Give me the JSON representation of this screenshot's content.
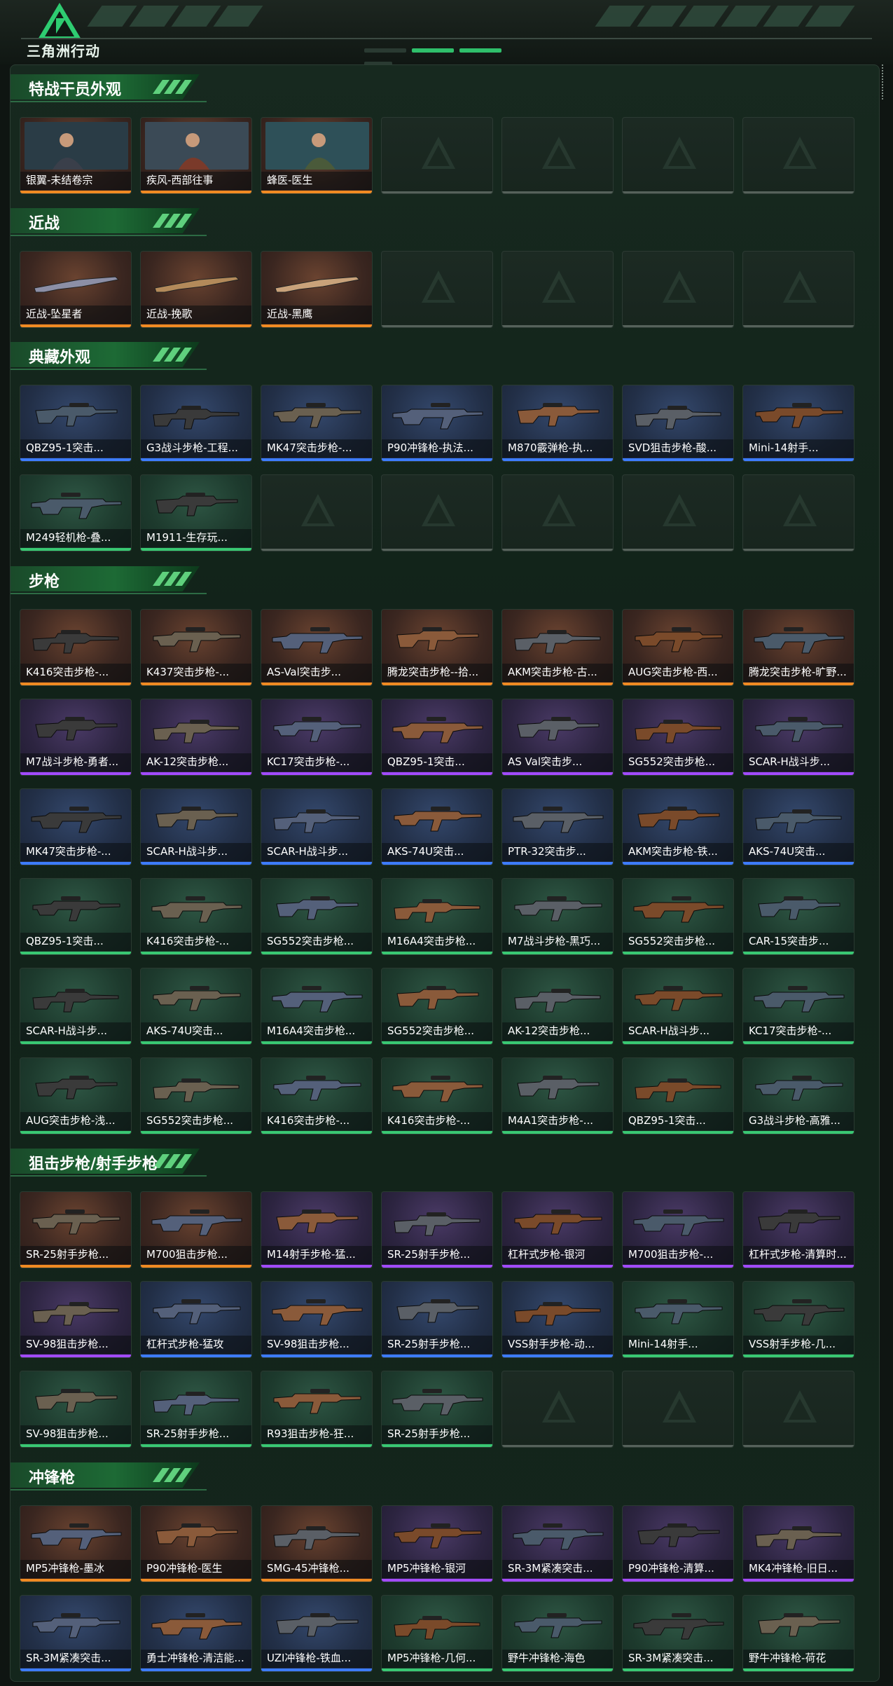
{
  "app": {
    "logo_text": "三角洲行动"
  },
  "colors": {
    "orange": "#f08a23",
    "purple": "#a24bff",
    "blue": "#3d7cff",
    "green": "#39c873",
    "gray": "#56625b",
    "accent": "#2ea35a"
  },
  "sections": [
    {
      "title": "特战干员外观",
      "items": [
        {
          "name": "银翼-未结卷宗",
          "rarity": "orange",
          "kind": "portrait"
        },
        {
          "name": "疾风-西部往事",
          "rarity": "orange",
          "kind": "portrait"
        },
        {
          "name": "蜂医-医生",
          "rarity": "orange",
          "kind": "portrait"
        },
        {
          "name": "",
          "rarity": "empty"
        },
        {
          "name": "",
          "rarity": "empty"
        },
        {
          "name": "",
          "rarity": "empty"
        },
        {
          "name": "",
          "rarity": "empty"
        }
      ]
    },
    {
      "title": "近战",
      "items": [
        {
          "name": "近战-坠星者",
          "rarity": "orange",
          "kind": "knife"
        },
        {
          "name": "近战-挽歌",
          "rarity": "orange",
          "kind": "knife"
        },
        {
          "name": "近战-黑鹰",
          "rarity": "orange",
          "kind": "knife"
        },
        {
          "name": "",
          "rarity": "empty"
        },
        {
          "name": "",
          "rarity": "empty"
        },
        {
          "name": "",
          "rarity": "empty"
        },
        {
          "name": "",
          "rarity": "empty"
        }
      ]
    },
    {
      "title": "典藏外观",
      "items": [
        {
          "name": "QBZ95-1突击...",
          "rarity": "blue"
        },
        {
          "name": "G3战斗步枪-工程...",
          "rarity": "blue"
        },
        {
          "name": "MK47突击步枪-...",
          "rarity": "blue"
        },
        {
          "name": "P90冲锋枪-执法...",
          "rarity": "blue"
        },
        {
          "name": "M870霰弹枪-执...",
          "rarity": "blue"
        },
        {
          "name": "SVD狙击步枪-酸...",
          "rarity": "blue"
        },
        {
          "name": "Mini-14射手...",
          "rarity": "blue"
        },
        {
          "name": "M249轻机枪-叠...",
          "rarity": "green"
        },
        {
          "name": "M1911-生存玩...",
          "rarity": "green"
        },
        {
          "name": "",
          "rarity": "empty"
        },
        {
          "name": "",
          "rarity": "empty"
        },
        {
          "name": "",
          "rarity": "empty"
        },
        {
          "name": "",
          "rarity": "empty"
        },
        {
          "name": "",
          "rarity": "empty"
        }
      ]
    },
    {
      "title": "步枪",
      "items": [
        {
          "name": "K416突击步枪-...",
          "rarity": "orange"
        },
        {
          "name": "K437突击步枪-...",
          "rarity": "orange"
        },
        {
          "name": "AS-Val突击步...",
          "rarity": "orange"
        },
        {
          "name": "腾龙突击步枪--拾...",
          "rarity": "orange"
        },
        {
          "name": "AKM突击步枪-古...",
          "rarity": "orange"
        },
        {
          "name": "AUG突击步枪-西...",
          "rarity": "orange"
        },
        {
          "name": "腾龙突击步枪-旷野...",
          "rarity": "orange"
        },
        {
          "name": "M7战斗步枪-勇者...",
          "rarity": "purple"
        },
        {
          "name": "AK-12突击步枪...",
          "rarity": "purple"
        },
        {
          "name": "KC17突击步枪-...",
          "rarity": "purple"
        },
        {
          "name": "QBZ95-1突击...",
          "rarity": "purple"
        },
        {
          "name": "AS Val突击步...",
          "rarity": "purple"
        },
        {
          "name": "SG552突击步枪...",
          "rarity": "purple"
        },
        {
          "name": "SCAR-H战斗步...",
          "rarity": "purple"
        },
        {
          "name": "MK47突击步枪-...",
          "rarity": "blue"
        },
        {
          "name": "SCAR-H战斗步...",
          "rarity": "blue"
        },
        {
          "name": "SCAR-H战斗步...",
          "rarity": "blue"
        },
        {
          "name": "AKS-74U突击...",
          "rarity": "blue"
        },
        {
          "name": "PTR-32突击步...",
          "rarity": "blue"
        },
        {
          "name": "AKM突击步枪-铁...",
          "rarity": "blue"
        },
        {
          "name": "AKS-74U突击...",
          "rarity": "blue"
        },
        {
          "name": "QBZ95-1突击...",
          "rarity": "green"
        },
        {
          "name": "K416突击步枪-...",
          "rarity": "green"
        },
        {
          "name": "SG552突击步枪...",
          "rarity": "green"
        },
        {
          "name": "M16A4突击步枪...",
          "rarity": "green"
        },
        {
          "name": "M7战斗步枪-黑巧...",
          "rarity": "green"
        },
        {
          "name": "SG552突击步枪...",
          "rarity": "green"
        },
        {
          "name": "CAR-15突击步...",
          "rarity": "green"
        },
        {
          "name": "SCAR-H战斗步...",
          "rarity": "green"
        },
        {
          "name": "AKS-74U突击...",
          "rarity": "green"
        },
        {
          "name": "M16A4突击步枪...",
          "rarity": "green"
        },
        {
          "name": "SG552突击步枪...",
          "rarity": "green"
        },
        {
          "name": "AK-12突击步枪...",
          "rarity": "green"
        },
        {
          "name": "SCAR-H战斗步...",
          "rarity": "green"
        },
        {
          "name": "KC17突击步枪-...",
          "rarity": "green"
        },
        {
          "name": "AUG突击步枪-浅...",
          "rarity": "green"
        },
        {
          "name": "SG552突击步枪...",
          "rarity": "green"
        },
        {
          "name": "K416突击步枪-...",
          "rarity": "green"
        },
        {
          "name": "K416突击步枪-...",
          "rarity": "green"
        },
        {
          "name": "M4A1突击步枪-...",
          "rarity": "green"
        },
        {
          "name": "QBZ95-1突击...",
          "rarity": "green"
        },
        {
          "name": "G3战斗步枪-高雅...",
          "rarity": "green"
        }
      ]
    },
    {
      "title": "狙击步枪/射手步枪",
      "items": [
        {
          "name": "SR-25射手步枪...",
          "rarity": "orange"
        },
        {
          "name": "M700狙击步枪...",
          "rarity": "orange"
        },
        {
          "name": "M14射手步枪-猛...",
          "rarity": "purple"
        },
        {
          "name": "SR-25射手步枪...",
          "rarity": "purple"
        },
        {
          "name": "杠杆式步枪-银河",
          "rarity": "purple"
        },
        {
          "name": "M700狙击步枪-...",
          "rarity": "purple"
        },
        {
          "name": "杠杆式步枪-清算时...",
          "rarity": "purple"
        },
        {
          "name": "SV-98狙击步枪...",
          "rarity": "purple"
        },
        {
          "name": "杠杆式步枪-猛攻",
          "rarity": "blue"
        },
        {
          "name": "SV-98狙击步枪...",
          "rarity": "blue"
        },
        {
          "name": "SR-25射手步枪...",
          "rarity": "blue"
        },
        {
          "name": "VSS射手步枪-动...",
          "rarity": "blue"
        },
        {
          "name": "Mini-14射手...",
          "rarity": "green"
        },
        {
          "name": "VSS射手步枪-几...",
          "rarity": "green"
        },
        {
          "name": "SV-98狙击步枪...",
          "rarity": "green"
        },
        {
          "name": "SR-25射手步枪...",
          "rarity": "green"
        },
        {
          "name": "R93狙击步枪-狂...",
          "rarity": "green"
        },
        {
          "name": "SR-25射手步枪...",
          "rarity": "green"
        },
        {
          "name": "",
          "rarity": "empty"
        },
        {
          "name": "",
          "rarity": "empty"
        },
        {
          "name": "",
          "rarity": "empty"
        }
      ]
    },
    {
      "title": "冲锋枪",
      "items": [
        {
          "name": "MP5冲锋枪-墨冰",
          "rarity": "orange"
        },
        {
          "name": "P90冲锋枪-医生",
          "rarity": "orange"
        },
        {
          "name": "SMG-45冲锋枪...",
          "rarity": "orange"
        },
        {
          "name": "MP5冲锋枪-银河",
          "rarity": "purple"
        },
        {
          "name": "SR-3M紧凑突击...",
          "rarity": "purple"
        },
        {
          "name": "P90冲锋枪-清算...",
          "rarity": "purple"
        },
        {
          "name": "MK4冲锋枪-旧日...",
          "rarity": "purple"
        },
        {
          "name": "SR-3M紧凑突击...",
          "rarity": "blue"
        },
        {
          "name": "勇士冲锋枪-清洁能...",
          "rarity": "blue"
        },
        {
          "name": "UZI冲锋枪-铁血...",
          "rarity": "blue"
        },
        {
          "name": "MP5冲锋枪-几何...",
          "rarity": "green"
        },
        {
          "name": "野牛冲锋枪-海色",
          "rarity": "green"
        },
        {
          "name": "SR-3M紧凑突击...",
          "rarity": "green"
        },
        {
          "name": "野牛冲锋枪-荷花",
          "rarity": "green"
        }
      ]
    }
  ]
}
